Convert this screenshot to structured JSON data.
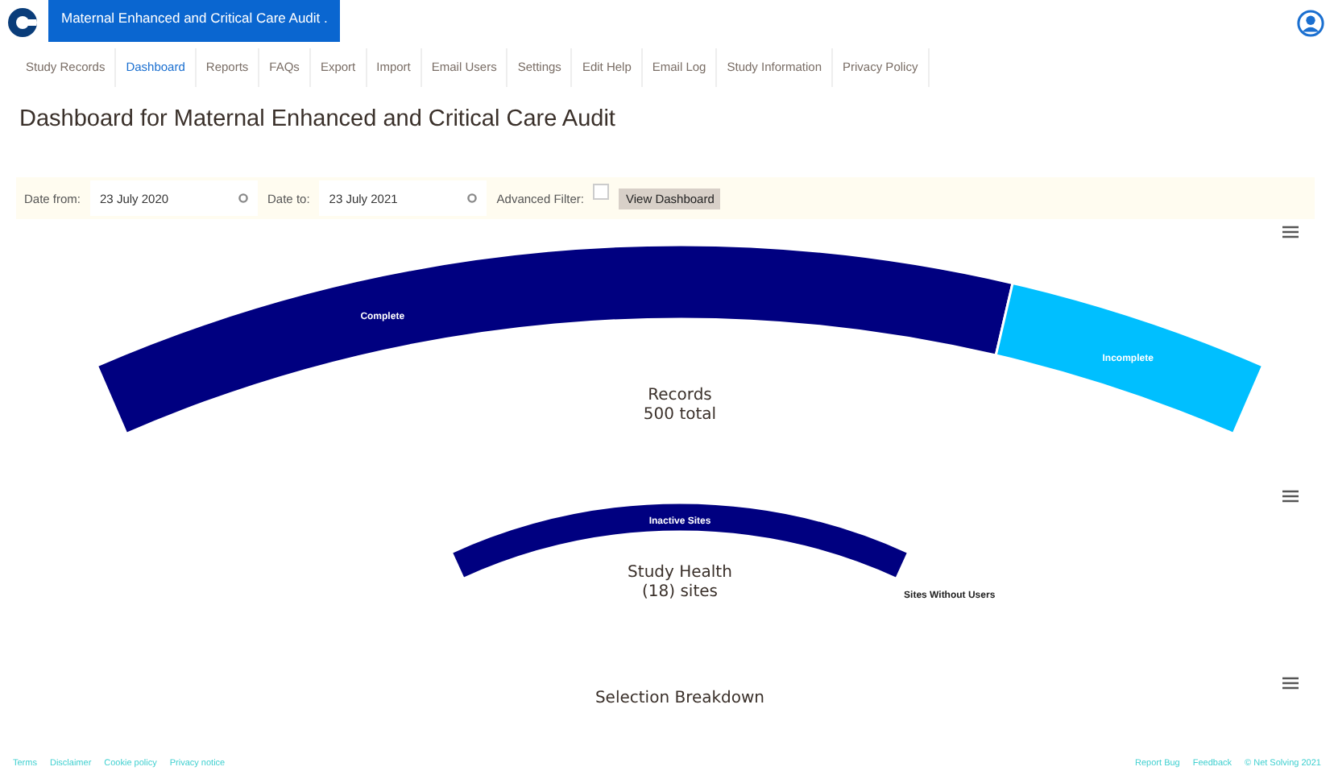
{
  "header": {
    "title": "Maternal Enhanced and Critical Care Audit ."
  },
  "nav": [
    {
      "label": "Study Records",
      "selected": false
    },
    {
      "label": "Dashboard",
      "selected": true
    },
    {
      "label": "Reports",
      "selected": false
    },
    {
      "label": "FAQs",
      "selected": false
    },
    {
      "label": "Export",
      "selected": false
    },
    {
      "label": "Import",
      "selected": false
    },
    {
      "label": "Email Users",
      "selected": false
    },
    {
      "label": "Settings",
      "selected": false
    },
    {
      "label": "Edit Help",
      "selected": false
    },
    {
      "label": "Email Log",
      "selected": false
    },
    {
      "label": "Study Information",
      "selected": false
    },
    {
      "label": "Privacy Policy",
      "selected": false
    }
  ],
  "heading": "Dashboard for Maternal Enhanced and Critical Care Audit",
  "filter": {
    "date_from_label": "Date from:",
    "date_from": "23 July 2020",
    "date_to_label": "Date to:",
    "date_to": "23 July 2021",
    "advanced_label": "Advanced Filter:",
    "advanced_checked": false,
    "button": "View Dashboard"
  },
  "charts": [
    {
      "title": "Records",
      "subtitle": "500 total",
      "segments": [
        {
          "label": "Complete",
          "color": "#000080"
        },
        {
          "label": "Incomplete",
          "color": "#00bfff"
        }
      ]
    },
    {
      "title": "Study Health",
      "subtitle": "(18) sites",
      "segments": [
        {
          "label": "Inactive Sites",
          "color": "#000080"
        },
        {
          "label": "Sites Without Users"
        }
      ]
    },
    {
      "title": "Selection Breakdown"
    }
  ],
  "footer": {
    "left": [
      "Terms",
      "Disclaimer",
      "Cookie policy",
      "Privacy notice"
    ],
    "right": [
      "Report Bug",
      "Feedback",
      "© Net Solving 2021"
    ]
  }
}
